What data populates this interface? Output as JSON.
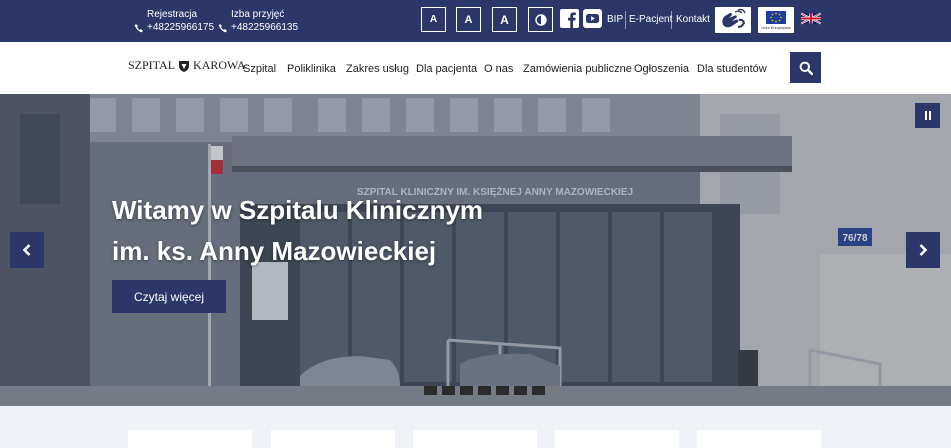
{
  "topbar": {
    "registration": {
      "label": "Rejestracja",
      "phone": "+48225966175"
    },
    "admission": {
      "label": "Izba przyjęć",
      "phone": "+48225966135"
    },
    "font_buttons": [
      "A",
      "A",
      "A"
    ],
    "links": {
      "bip": "BIP",
      "epacjent": "E-Pacjent",
      "contact": "Kontakt"
    },
    "eu_badge_text": "Unia Europejska"
  },
  "nav": {
    "logo_left": "SZPITAL",
    "logo_right": "KAROWA",
    "items": [
      "Szpital",
      "Poliklinika",
      "Zakres usług",
      "Dla pacjenta",
      "O nas",
      "Zamówienia publiczne",
      "Ogłoszenia",
      "Dla studentów"
    ]
  },
  "hero": {
    "title_line1": "Witamy w Szpitalu Klinicznym",
    "title_line2": "im. ks. Anny Mazowieckiej",
    "button": "Czytaj więcej",
    "building_sign": "SZPITAL KLINICZNY IM. KSIĘŻNEJ ANNY MAZOWIECKIEJ",
    "street_number": "76/78",
    "slide_count": 7
  },
  "colors": {
    "navy": "#2b3768",
    "page_bg": "#eef1f6"
  },
  "icons": [
    "phone-icon",
    "contrast-icon",
    "facebook-icon",
    "youtube-icon",
    "sign-language-icon",
    "eu-flag-icon",
    "uk-flag-icon",
    "search-icon",
    "chevron-left-icon",
    "chevron-right-icon",
    "pause-icon"
  ]
}
